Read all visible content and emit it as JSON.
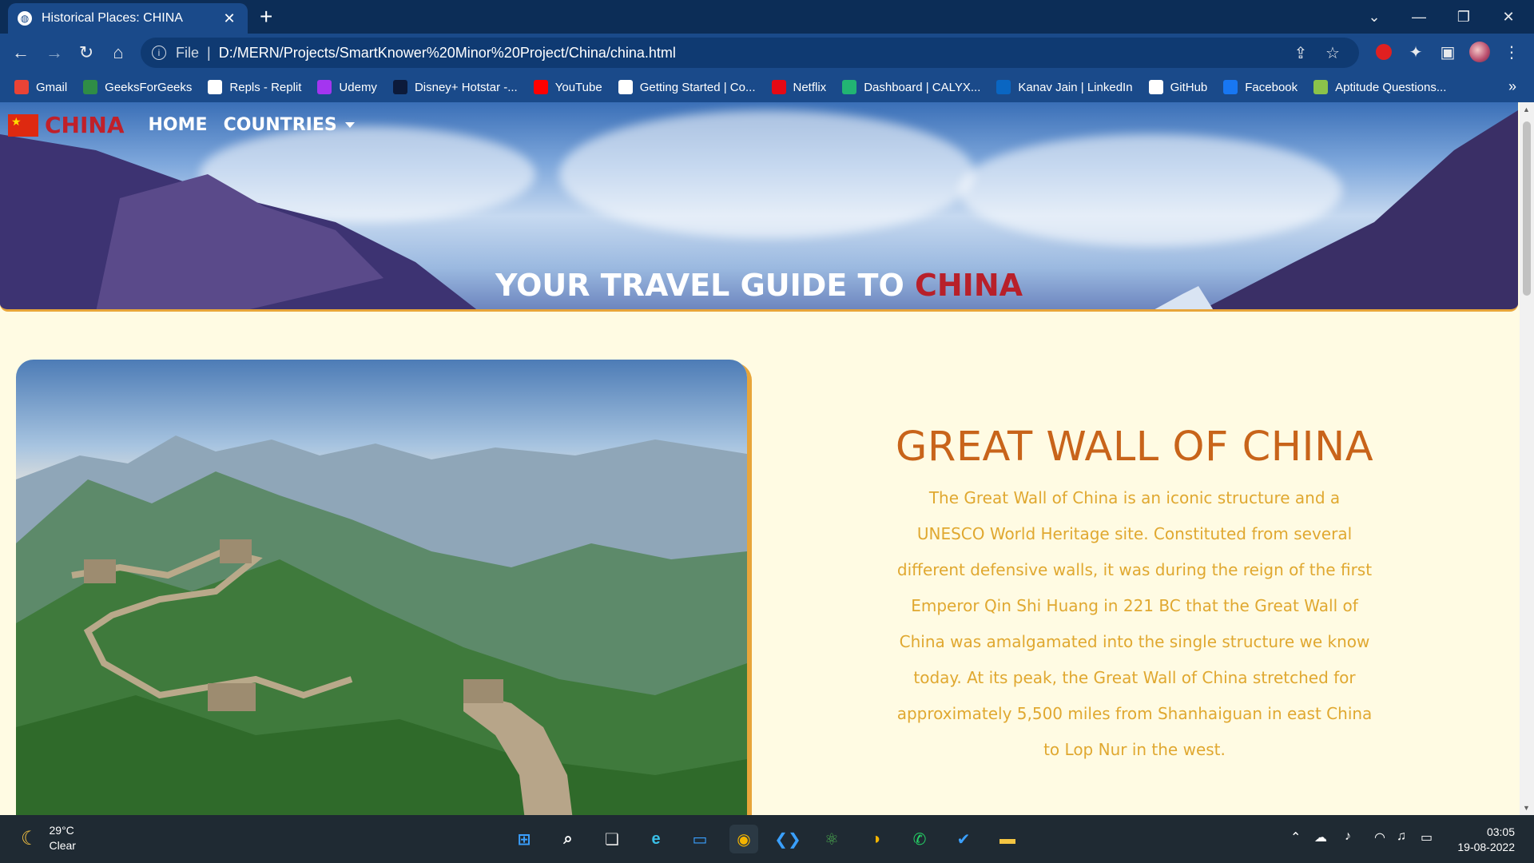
{
  "browser": {
    "tab_title": "Historical Places: CHINA",
    "address_scheme": "File",
    "address_url": "D:/MERN/Projects/SmartKnower%20Minor%20Project/China/china.html"
  },
  "bookmarks": [
    {
      "label": "Gmail",
      "icon": "gmail-icon",
      "color": "#ea4335"
    },
    {
      "label": "GeeksForGeeks",
      "icon": "gfg-icon",
      "color": "#2f8d46"
    },
    {
      "label": "Repls - Replit",
      "icon": "replit-icon",
      "color": "#ffffff"
    },
    {
      "label": "Udemy",
      "icon": "udemy-icon",
      "color": "#a435f0"
    },
    {
      "label": "Disney+ Hotstar -...",
      "icon": "hotstar-icon",
      "color": "#0c1a3a"
    },
    {
      "label": "YouTube",
      "icon": "youtube-icon",
      "color": "#ff0000"
    },
    {
      "label": "Getting Started | Co...",
      "icon": "cc-icon",
      "color": "#ffffff"
    },
    {
      "label": "Netflix",
      "icon": "netflix-icon",
      "color": "#e50914"
    },
    {
      "label": "Dashboard | CALYX...",
      "icon": "calyx-icon",
      "color": "#22b573"
    },
    {
      "label": "Kanav Jain | LinkedIn",
      "icon": "linkedin-icon",
      "color": "#0a66c2"
    },
    {
      "label": "GitHub",
      "icon": "github-icon",
      "color": "#ffffff"
    },
    {
      "label": "Facebook",
      "icon": "facebook-icon",
      "color": "#1877f2"
    },
    {
      "label": "Aptitude Questions...",
      "icon": "aptitude-icon",
      "color": "#8bc34a"
    }
  ],
  "page": {
    "brand": "CHINA",
    "nav_home": "HOME",
    "nav_countries": "COUNTRIES",
    "hero_prefix": "YOUR TRAVEL GUIDE TO ",
    "hero_accent": "CHINA",
    "section_title": "GREAT WALL OF CHINA",
    "section_text": "The Great Wall of China is an iconic structure and a UNESCO World Heritage site. Constituted from several different defensive walls, it was during the reign of the first Emperor Qin Shi Huang in 221 BC that the Great Wall of China was amalgamated into the single structure we know today. At its peak, the Great Wall of China stretched for approximately 5,500 miles from Shanhaiguan in east China to Lop Nur in the west."
  },
  "colors": {
    "page_bg": "#fffbe3",
    "brand_red": "#c0202a",
    "title_orange": "#c8641a",
    "text_gold": "#e0a830",
    "accent_border": "#e8a53a"
  },
  "taskbar": {
    "temperature": "29°C",
    "weather": "Clear",
    "time": "03:05",
    "date": "19-08-2022"
  }
}
